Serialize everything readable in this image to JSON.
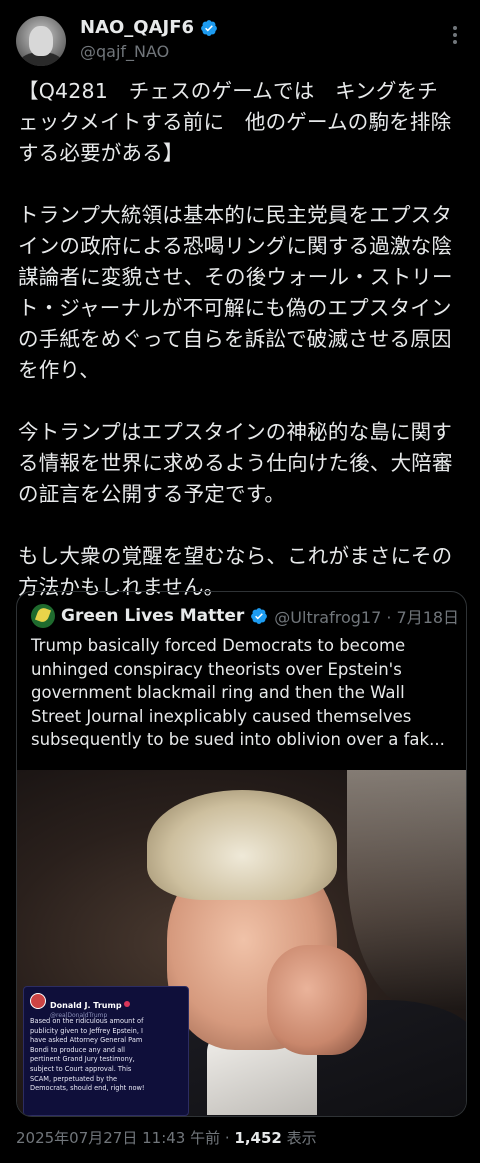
{
  "author": {
    "display_name": "NAO_QAJF6",
    "handle": "@qajf_NAO"
  },
  "tweet": {
    "lines": [
      "【Q4281　チェスのゲームでは　キングをチ",
      "ェックメイトする前に　他のゲームの駒を排除",
      "する必要がある】",
      "",
      "トランプ大統領は基本的に民主党員をエプスタ",
      "インの政府による恐喝リングに関する過激な陰",
      "謀論者に変貌させ、その後ウォール・ストリー",
      "ト・ジャーナルが不可解にも偽のエプスタイン",
      "の手紙をめぐって自らを訴訟で破滅させる原因",
      "を作り、",
      "",
      "今トランプはエプスタインの神秘的な島に関す",
      "る情報を世界に求めるよう仕向けた後、大陪審",
      "の証言を公開する予定です。",
      "",
      "もし大衆の覚醒を望むなら、これがまさにその",
      "方法かもしれません。"
    ]
  },
  "quote": {
    "display_name": "Green Lives Matter",
    "handle_date": "@Ultrafrog17 · 7月18日",
    "lines": [
      "Trump basically forced Democrats to become",
      "unhinged conspiracy theorists over Epstein's",
      "government blackmail ring and then the Wall",
      "Street Journal inexplicably caused themselves",
      "subsequently to be sued into oblivion over a fak..."
    ],
    "embed": {
      "name": "Donald J. Trump",
      "handle": "@realDonaldTrump",
      "lines": [
        "Based on the ridiculous amount of",
        "publicity given to Jeffrey Epstein, I",
        "have asked Attorney General Pam",
        "Bondi to produce any and all",
        "pertinent Grand Jury testimony,",
        "subject to Court approval. This",
        "SCAM, perpetuated by the",
        "Democrats, should end, right now!"
      ]
    }
  },
  "meta": {
    "timestamp": "2025年07月27日 11:43 午前 · ",
    "views_count": "1,452",
    "views_label": " 表示"
  },
  "colors": {
    "background": "#000000",
    "text": "#e7e9ea",
    "muted": "#71767b",
    "verified": "#1d9bf0",
    "border": "#2f3336"
  }
}
